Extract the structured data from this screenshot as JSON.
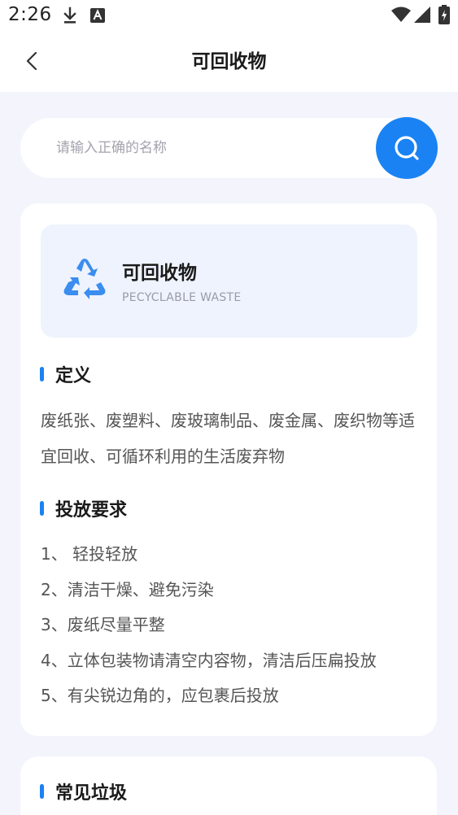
{
  "status_bar": {
    "time": "2:26",
    "icons": [
      "download-icon",
      "a-letter-icon",
      "wifi-icon",
      "cell-signal-icon",
      "battery-charging-icon"
    ]
  },
  "header": {
    "title": "可回收物",
    "back_icon": "chevron-left-icon"
  },
  "search": {
    "placeholder": "请输入正确的名称",
    "value": "",
    "button_icon": "search-icon"
  },
  "category": {
    "title": "可回收物",
    "subtitle": "PECYCLABLE WASTE",
    "icon": "recycle-icon"
  },
  "definition": {
    "heading": "定义",
    "text": "废纸张、废塑料、废玻璃制品、废金属、废织物等适宜回收、可循环利用的生活废弃物"
  },
  "requirements": {
    "heading": "投放要求",
    "items": [
      "1、 轻投轻放",
      "2、清洁干燥、避免污染",
      "3、废纸尽量平整",
      "4、立体包装物请清空内容物，清洁后压扁投放",
      "5、有尖锐边角的，应包裹后投放"
    ]
  },
  "common": {
    "heading": "常见垃圾"
  },
  "colors": {
    "accent": "#1a82f3",
    "background": "#f3f4fc",
    "hero_bg": "#eef3fd"
  }
}
